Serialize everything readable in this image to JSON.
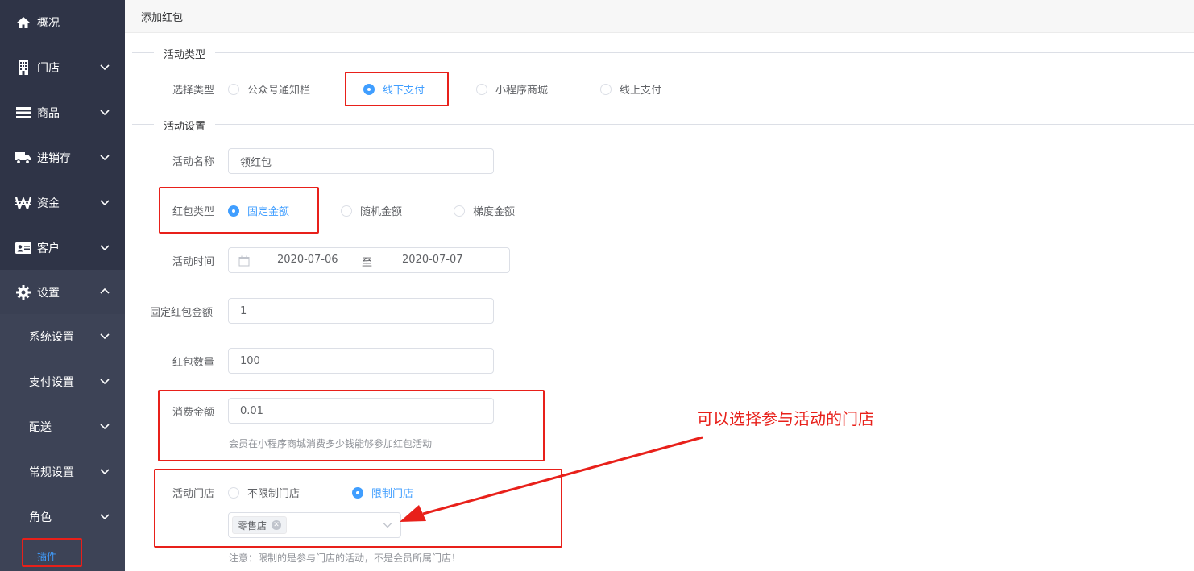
{
  "sidebar": {
    "items": [
      {
        "label": "概况",
        "icon": "home-icon"
      },
      {
        "label": "门店",
        "icon": "building-icon"
      },
      {
        "label": "商品",
        "icon": "list-icon"
      },
      {
        "label": "进销存",
        "icon": "truck-icon"
      },
      {
        "label": "资金",
        "icon": "won-icon"
      },
      {
        "label": "客户",
        "icon": "id-card-icon"
      },
      {
        "label": "设置",
        "icon": "gear-icon"
      }
    ],
    "sub_items": [
      "系统设置",
      "支付设置",
      "配送",
      "常规设置",
      "角色"
    ],
    "plugin": "插件"
  },
  "topbar": {
    "title": "添加红包"
  },
  "form": {
    "section_type": "活动类型",
    "select_type_label": "选择类型",
    "type_options": [
      "公众号通知栏",
      "线下支付",
      "小程序商城",
      "线上支付"
    ],
    "type_selected": "线下支付",
    "section_settings": "活动设置",
    "name_label": "活动名称",
    "name_value": "领红包",
    "packet_type_label": "红包类型",
    "packet_type_options": [
      "固定金额",
      "随机金额",
      "梯度金额"
    ],
    "packet_type_selected": "固定金额",
    "time_label": "活动时间",
    "time_start": "2020-07-06",
    "time_sep": "至",
    "time_end": "2020-07-07",
    "fixed_amount_label": "固定红包金额",
    "fixed_amount_value": "1",
    "count_label": "红包数量",
    "count_value": "100",
    "consume_label": "消费金额",
    "consume_value": "0.01",
    "consume_hint": "会员在小程序商城消费多少钱能够参加红包活动",
    "store_label": "活动门店",
    "store_options": [
      "不限制门店",
      "限制门店"
    ],
    "store_selected": "限制门店",
    "store_tag": "零售店",
    "store_note": "注意：限制的是参与门店的活动，不是会员所属门店！"
  },
  "annotation": {
    "text": "可以选择参与活动的门店",
    "color": "#e8201a"
  },
  "colors": {
    "sidebar_bg": "#2f3447",
    "accent": "#409eff",
    "highlight": "#e8201a"
  }
}
